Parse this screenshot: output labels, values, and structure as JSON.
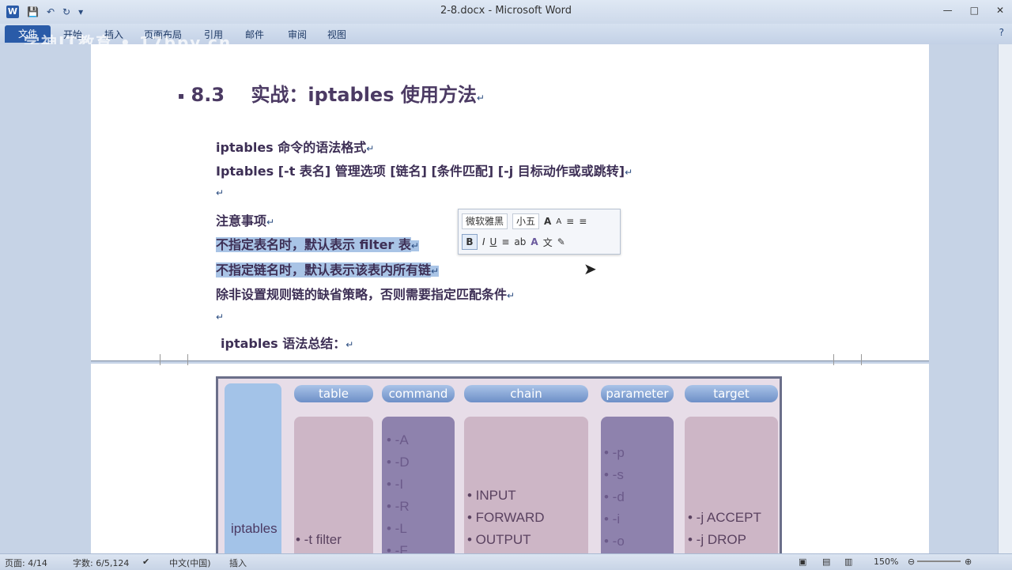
{
  "window": {
    "title": "2-8.docx - Microsoft Word",
    "app_icon_letter": "W",
    "quick_access": [
      "save-icon",
      "undo-icon",
      "redo-icon"
    ],
    "controls": [
      "—",
      "□",
      "✕"
    ]
  },
  "ribbon": {
    "file_tab": "文件",
    "tabs": [
      "开始",
      "插入",
      "页面布局",
      "引用",
      "邮件",
      "审阅",
      "视图"
    ],
    "overlay_text": "学神IT教育 • 17bpy.cn",
    "help": "?"
  },
  "document": {
    "heading_number": "8.3",
    "heading_text": "实战：iptables 使用方法",
    "lines": [
      "iptables 命令的语法格式",
      "Iptables [-t 表名] 管理选项 [链名] [条件匹配] [-j 目标动作或或跳转]",
      "",
      "注意事项",
      "不指定表名时，默认表示 filter 表",
      "不指定链名时，默认表示该表内所有链",
      "除非设置规则链的缺省策略，否则需要指定匹配条件",
      "",
      "iptables 语法总结："
    ],
    "paragraph_mark": "↵"
  },
  "mini_toolbar": {
    "font": "微软雅黑",
    "size": "小五",
    "buttons_row1": [
      "A",
      "A",
      "≡",
      "≡"
    ],
    "buttons_row2": [
      "B",
      "I",
      "U",
      "≡",
      "ab",
      "A",
      "文",
      "✎"
    ]
  },
  "diagram": {
    "left_label": "iptables",
    "headers": [
      "table",
      "command",
      "chain",
      "parameter",
      "target"
    ],
    "table_items": [
      "• -t  filter"
    ],
    "command_items": [
      "• -A",
      "• -D",
      "• -I",
      "• -R",
      "• -L",
      "• -F"
    ],
    "chain_items": [
      "• INPUT",
      "• FORWARD",
      "• OUTPUT"
    ],
    "parameter_items": [
      "• -p",
      "• -s",
      "• -d",
      "• -i",
      "• -o"
    ],
    "target_items": [
      "• -j  ACCEPT",
      "• -j  DROP"
    ]
  },
  "statusbar": {
    "page": "页面: 4/14",
    "words": "字数: 6/5,124",
    "language": "中文(中国)",
    "mode": "插入",
    "zoom": "150%"
  }
}
